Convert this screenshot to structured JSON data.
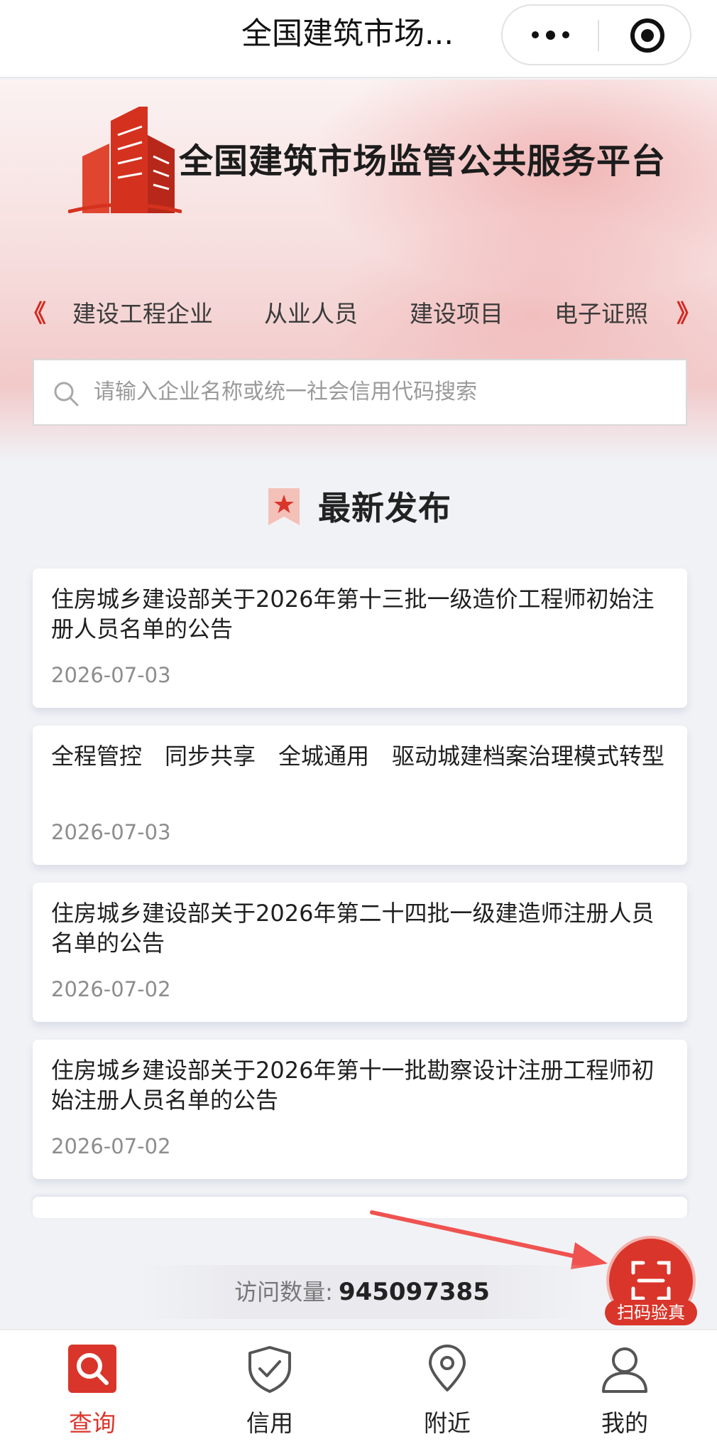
{
  "window": {
    "title": "全国建筑市场..."
  },
  "hero": {
    "platform_title": "全国建筑市场监管公共服务平台",
    "nav_prev": "《",
    "nav_next": "》",
    "nav_tabs": [
      "建设工程企业",
      "从业人员",
      "建设项目",
      "电子证照"
    ],
    "search_placeholder": "请输入企业名称或统一社会信用代码搜索"
  },
  "section": {
    "title": "最新发布"
  },
  "news": [
    {
      "title": "住房城乡建设部关于2026年第十三批一级造价工程师初始注册人员名单的公告",
      "date": "2026-07-03"
    },
    {
      "title": "全程管控　同步共享　全城通用　驱动城建档案治理模式转型",
      "date": "2026-07-03"
    },
    {
      "title": "住房城乡建设部关于2026年第二十四批一级建造师注册人员名单的公告",
      "date": "2026-07-02"
    },
    {
      "title": "住房城乡建设部关于2026年第十一批勘察设计注册工程师初始注册人员名单的公告",
      "date": "2026-07-02"
    }
  ],
  "visits": {
    "label": "访问数量:",
    "count": "945097385"
  },
  "scan": {
    "label": "扫码验真"
  },
  "tabbar": {
    "active_color": "#d9352a",
    "items": [
      {
        "label": "查询",
        "icon": "search-icon",
        "active": true
      },
      {
        "label": "信用",
        "icon": "shield-check-icon",
        "active": false
      },
      {
        "label": "附近",
        "icon": "location-pin-icon",
        "active": false
      },
      {
        "label": "我的",
        "icon": "user-icon",
        "active": false
      }
    ]
  },
  "colors": {
    "brand_red": "#d9352a",
    "background": "#f1f2f6"
  }
}
